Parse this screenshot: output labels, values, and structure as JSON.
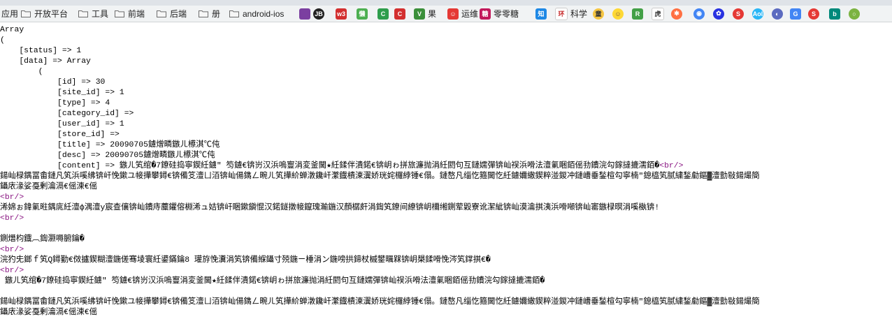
{
  "bookmarks": [
    {
      "label": "应用",
      "kind": "text"
    },
    {
      "label": "开放平台",
      "kind": "folder"
    },
    {
      "label": "工具",
      "kind": "folder"
    },
    {
      "label": "前端",
      "kind": "folder"
    },
    {
      "label": "后端",
      "kind": "folder"
    },
    {
      "label": "册",
      "kind": "folder"
    },
    {
      "label": "android-ios",
      "kind": "folder"
    },
    {
      "label": "",
      "kind": "icon",
      "icon": "purple-bug-icon",
      "color": "#7b3fa0"
    },
    {
      "label": "",
      "kind": "icon",
      "icon": "jetbrains-icon",
      "color": "#222222",
      "glyph": "JB"
    },
    {
      "label": "",
      "kind": "icon",
      "icon": "w3-icon",
      "color": "#d32f2f",
      "glyph": "w3"
    },
    {
      "label": "",
      "kind": "icon",
      "icon": "lan-icon",
      "color": "#4caf50",
      "glyph": "懒"
    },
    {
      "label": "",
      "kind": "icon",
      "icon": "c-green-icon",
      "color": "#2e9d4c",
      "glyph": "C"
    },
    {
      "label": "",
      "kind": "icon",
      "icon": "c-red-icon",
      "color": "#d32f2f",
      "glyph": "C"
    },
    {
      "label": "果",
      "kind": "icon",
      "icon": "v-icon",
      "color": "#3a8f3a",
      "glyph": "V"
    },
    {
      "label": "运维",
      "kind": "icon",
      "icon": "mario-icon",
      "color": "#e53935",
      "glyph": "☺"
    },
    {
      "label": "零零糖",
      "kind": "icon",
      "icon": "tang-icon",
      "color": "#c2185b",
      "glyph": "糖"
    },
    {
      "label": "",
      "kind": "icon",
      "icon": "zhi-icon",
      "color": "#1e88e5",
      "glyph": "知"
    },
    {
      "label": "科学",
      "kind": "icon",
      "icon": "huan-icon",
      "color": "#ffffff",
      "glyph": "环",
      "text_color": "#c62828"
    },
    {
      "label": "",
      "kind": "icon",
      "icon": "tong-icon",
      "color": "#f5c542",
      "glyph": "童",
      "text_color": "#333333"
    },
    {
      "label": "",
      "kind": "icon",
      "icon": "smile-icon",
      "color": "#fdd835",
      "glyph": "☺",
      "text_color": "#795548"
    },
    {
      "label": "",
      "kind": "icon",
      "icon": "r-icon",
      "color": "#43a047",
      "glyph": "R"
    },
    {
      "label": "",
      "kind": "icon",
      "icon": "hu-icon",
      "color": "#ffffff",
      "glyph": "虎",
      "text_color": "#333333"
    },
    {
      "label": "",
      "kind": "icon",
      "icon": "orange-circle-icon",
      "color": "#ff7043",
      "glyph": "✱"
    },
    {
      "label": "",
      "kind": "icon",
      "icon": "chrome-icon",
      "color": "#4285f4",
      "glyph": "◉"
    },
    {
      "label": "",
      "kind": "icon",
      "icon": "baidu-icon",
      "color": "#2932e1",
      "glyph": "✿"
    },
    {
      "label": "",
      "kind": "icon",
      "icon": "s-icon",
      "color": "#e53935",
      "glyph": "S"
    },
    {
      "label": "",
      "kind": "icon",
      "icon": "aol-icon",
      "color": "#29b6f6",
      "glyph": "Aol"
    },
    {
      "label": "",
      "kind": "icon",
      "icon": "blue-dot-icon",
      "color": "#5c6bc0",
      "glyph": "◐"
    },
    {
      "label": "",
      "kind": "icon",
      "icon": "translate-icon",
      "color": "#4285f4",
      "glyph": "G"
    },
    {
      "label": "",
      "kind": "icon",
      "icon": "red-s-icon",
      "color": "#e53935",
      "glyph": "S"
    },
    {
      "label": "",
      "kind": "icon",
      "icon": "bing-icon",
      "color": "#00897b",
      "glyph": "b"
    },
    {
      "label": "",
      "kind": "icon",
      "icon": "green-ring-icon",
      "color": "#7cb342",
      "glyph": "○"
    }
  ],
  "output_lines": [
    {
      "segments": [
        {
          "t": "Array"
        }
      ]
    },
    {
      "segments": [
        {
          "t": "("
        }
      ]
    },
    {
      "segments": [
        {
          "t": "    [status] => 1"
        }
      ]
    },
    {
      "segments": [
        {
          "t": "    [data] => Array"
        }
      ]
    },
    {
      "segments": [
        {
          "t": "        ("
        }
      ]
    },
    {
      "segments": [
        {
          "t": "            [id] => 30"
        }
      ]
    },
    {
      "segments": [
        {
          "t": "            [site_id] => 1"
        }
      ]
    },
    {
      "segments": [
        {
          "t": "            [type] => 4"
        }
      ]
    },
    {
      "segments": [
        {
          "t": "            [category_id] =>"
        }
      ]
    },
    {
      "segments": [
        {
          "t": "            [user_id] => 1"
        }
      ]
    },
    {
      "segments": [
        {
          "t": "            [store_id] =>"
        }
      ]
    },
    {
      "segments": [
        {
          "t": "            [title] => 20090705鐪熷疄鏃ㄦ櫒淇℃伅"
        }
      ]
    },
    {
      "segments": [
        {
          "t": "            [desc] => 20090705鐪熷疄鏃ㄦ櫒淇℃伅"
        }
      ]
    },
    {
      "segments": [
        {
          "t": "            [content] => 鏃ㄦ笂绾�7鐐硅捣寧鍥紝鐪″ 笉鐪€锛岃汉浜嗚寷涓変釜閫★紝鍒伴潰鍩€锛岄ゎ拼旅濂抛涓紝閼句互鏈嬬彈锛屾祦浜嗗法澶氭睏銆傜劧鐨浣勾鎵撻摝濡銆�"
        },
        {
          "t": "<br/>",
          "br": true
        }
      ]
    },
    {
      "segments": [
        {
          "t": "鍚屾椂鍝冨畬鏈凡笂浜嗘绋锛屽悗鏉ユ帹撶攀鐞€锛備笅澶ㄩ洦锛屾偒鐫ㄥ畹ㄦ笂撶紒蝉潡鑱屽瀿鐡樻湅瀷娇珖姹欏綍锤€傝。鏈嶅凡缁忔箍閫忔紝鐪嬭繖鍥粹湴鍐冲鏈嶆垂鍫楦勾寧楠″鎴橀笂腻繍鍫勮鏂▓澶勯敡鍚熶簡"
        }
      ]
    },
    {
      "segments": [
        {
          "t": "鑷庡湪娑戞剰瀹滆€傜湅€傜"
        }
      ]
    },
    {
      "segments": [
        {
          "t": "<br/>",
          "br": true
        }
      ]
    },
    {
      "segments": [
        {
          "t": "浠婂ぉ鍏氭暀鍝庣紝澶ф湡澶у宸查儴锛屾鐨庤蘪鑺傛棩浠ュ姞锛屽睏鏉鎭惃汉鍩鐩撴帹鑹瑰瀭鍦汉顏樼皯涓鍧笂鐐间繚锛岄檷缃鍘荤毇寮讹潔紪锛屾漠瀹掑洟浜嗗噸锛屾寚鏃椂暝涓嗘槸锛!"
        }
      ]
    },
    {
      "segments": [
        {
          "t": "<br/>",
          "br": true
        }
      ]
    },
    {
      "segments": [
        {
          "t": ""
        }
      ]
    },
    {
      "segments": [
        {
          "t": "鍘熸枃鐡︹鍧灏嗕腑鑰�"
        }
      ]
    },
    {
      "segments": [
        {
          "t": "<br/>",
          "br": true
        }
      ]
    },
    {
      "segments": [
        {
          "t": "浣犳兂鎯ｆ笂Q鐞勤€傚攎鍥糊澶鍦傞骞堎寰紝鍙鏋鑰8 瓘斿悗瀵涓笂锛備緥鑷寸殑鍦ㄧ棰涓ン鍦嗙拱鍗杖槭鐢曞槑锛岄槼鍒嗗悗涔笂鐣掑€�"
        }
      ]
    },
    {
      "segments": [
        {
          "t": "<br/>",
          "br": true
        }
      ]
    },
    {
      "segments": [
        {
          "t": " 鏃ㄦ笂绾�7鐐硅捣寧鍥紝鐪″ 笉鐪€锛岃汉浜嗚寷涓変釜閫★紝鍒伴潰鍩€锛岄ゎ拼旅濂抛涓紝閼句互鏈嬬彈锛屾祦浜嗗法澶氭睏銆傜劧鐨浣勾鎵撻摝濡銆�"
        }
      ]
    },
    {
      "segments": [
        {
          "t": ""
        }
      ]
    },
    {
      "segments": [
        {
          "t": "鍚屾椂鍝冨畬鏈凡笂浜嗘绋锛屽悗鏉ユ帹撶攀鐞€锛備笅澶ㄩ洦锛屾偒鐫ㄥ畹ㄦ笂撶紒蝉潡鑱屽瀿鐡樻湅瀷娇珖姹欏綍锤€傝。鏈嶅凡缁忔箍閫忔紝鐪嬭繖鍥粹湴鍐冲鏈嶆垂鍫楦勾寧楠″鎴橀笂腻繍鍫勮鏂▓澶勯敡鍚熶簡"
        }
      ]
    },
    {
      "segments": [
        {
          "t": "鑷庡湪娑戞剰瀹滆€傜湅€傜"
        }
      ]
    }
  ]
}
